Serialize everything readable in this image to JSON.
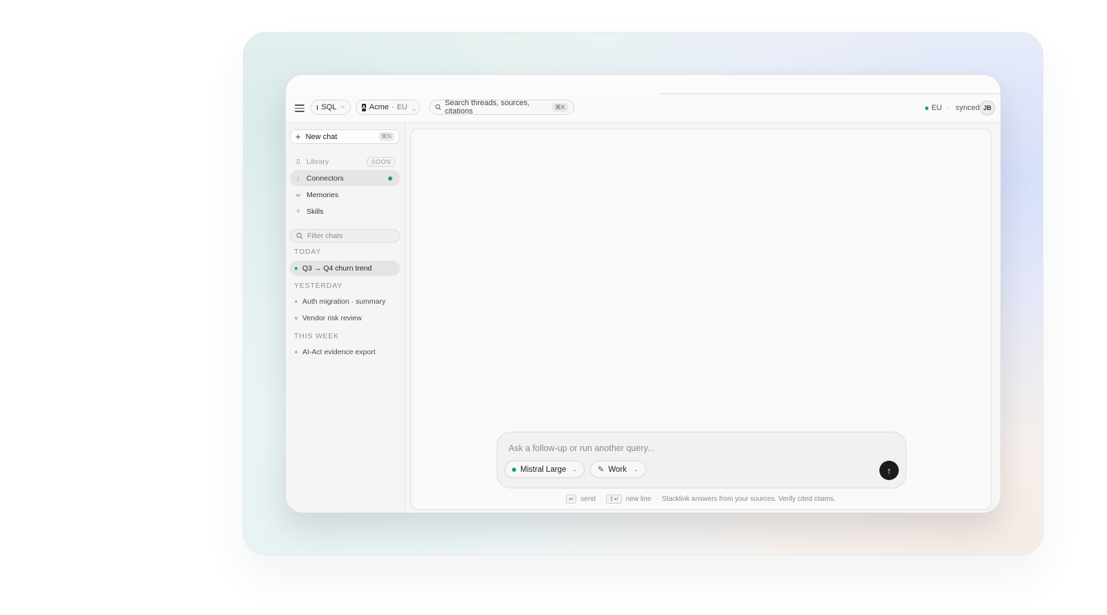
{
  "topbar": {
    "mode_pill": {
      "label": "SQL",
      "shortcut_glyph": "⌗"
    },
    "org_pill": {
      "logo_letter": "A",
      "name": "Acme",
      "separator": "·",
      "region": "EU",
      "caret": "⌄"
    },
    "search": {
      "placeholder": "Search threads, sources, citations",
      "shortcut": "⌘K"
    },
    "status": {
      "region": "EU",
      "separator": "·",
      "sync": "synced"
    },
    "avatar_initials": "JB"
  },
  "sidebar": {
    "new_chat": {
      "label": "New chat",
      "shortcut": "⌘N"
    },
    "nav": [
      {
        "label": "Library",
        "badge": "SOON",
        "icon": "book-icon"
      },
      {
        "label": "Connectors",
        "icon": "plug-icon",
        "status": "active"
      },
      {
        "label": "Memories",
        "icon": "infinity-icon"
      },
      {
        "label": "Skills",
        "icon": "sparkle-icon"
      }
    ],
    "filter": {
      "placeholder": "Filter chats"
    },
    "groups": [
      {
        "label": "TODAY",
        "chats": [
          "Q3 → Q4 churn trend"
        ]
      },
      {
        "label": "YESTERDAY",
        "chats": [
          "Auth migration · summary",
          "Vendor risk review"
        ]
      },
      {
        "label": "THIS WEEK",
        "chats": [
          "AI-Act evidence export"
        ]
      }
    ]
  },
  "composer": {
    "placeholder": "Ask a follow-up or run another query...",
    "model": "Mistral Large",
    "mode": "Work",
    "send_icon": "arrow-up-icon"
  },
  "footer": {
    "send_key": "↵",
    "send_label": "send",
    "newline_key": "⇧↵",
    "newline_label": "new line",
    "disclaimer": "Stacklink answers from your sources. Verify cited claims.",
    "separator": "·"
  },
  "colors": {
    "accent_green": "#1fa154",
    "send_button": "#1b1b1b"
  }
}
